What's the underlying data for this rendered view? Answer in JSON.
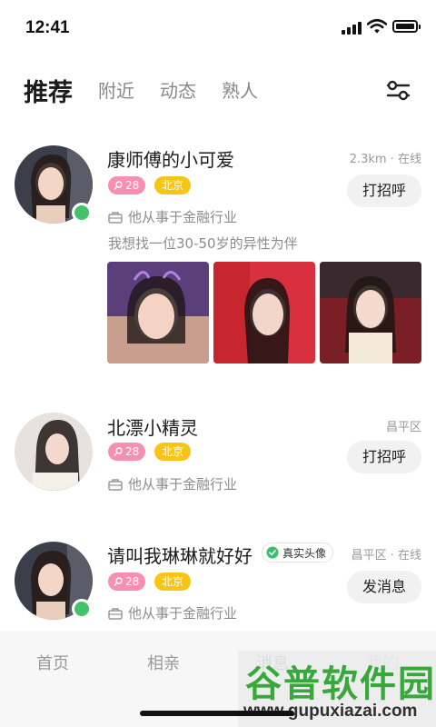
{
  "status_bar": {
    "time": "12:41"
  },
  "tabs": [
    {
      "label": "推荐",
      "active": true
    },
    {
      "label": "附近",
      "active": false
    },
    {
      "label": "动态",
      "active": false
    },
    {
      "label": "熟人",
      "active": false
    }
  ],
  "filter_icon": "sliders-icon",
  "cards": [
    {
      "name": "康师傅的小可爱",
      "meta": "2.3km · 在线",
      "age": "28",
      "city": "北京",
      "job": "他从事于金融行业",
      "bio": "我想找一位30-50岁的异性为伴",
      "action": "打招呼",
      "online": true,
      "photo_count": 3
    },
    {
      "name": "北漂小精灵",
      "meta": "昌平区",
      "age": "28",
      "city": "北京",
      "job": "他从事于金融行业",
      "action": "打招呼",
      "online": false
    },
    {
      "name": "请叫我琳琳就好好",
      "verified_label": "真实头像",
      "meta": "昌平区 · 在线",
      "age": "28",
      "city": "北京",
      "job": "他从事于金融行业",
      "action": "发消息",
      "online": true
    }
  ],
  "bottom_nav": [
    {
      "label": "首页",
      "active": false
    },
    {
      "label": "相亲",
      "active": false
    },
    {
      "label": "消息",
      "active": true
    },
    {
      "label": "我的",
      "active": false
    }
  ],
  "watermark": {
    "title": "谷普软件园",
    "url": "www.gupuxiazai.com"
  },
  "colors": {
    "online": "#42c26a",
    "age_badge": "#f78fb2",
    "city_badge": "#f7c516",
    "button_bg": "#f1f1f1",
    "watermark_green": "#38a83b"
  }
}
